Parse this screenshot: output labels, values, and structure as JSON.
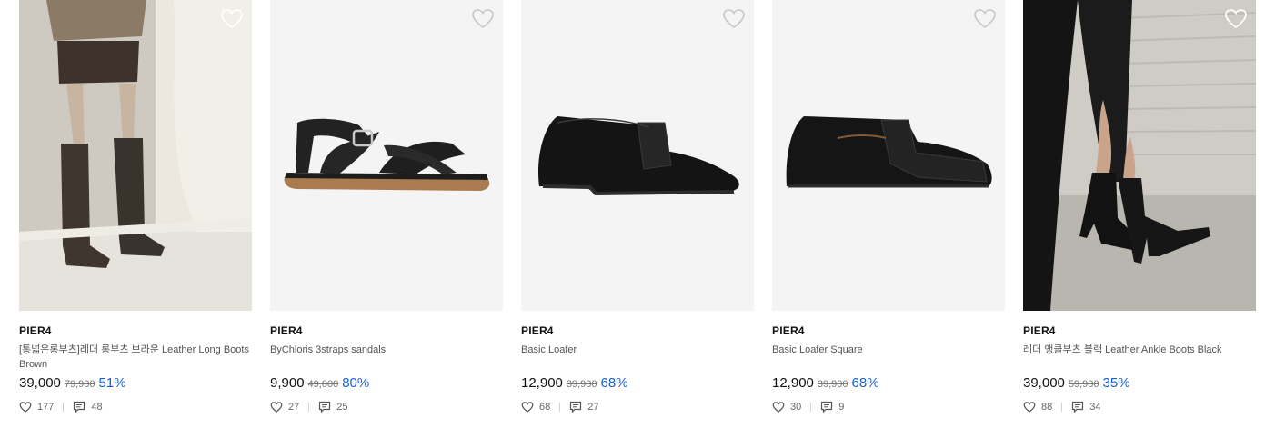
{
  "products": [
    {
      "brand": "PIER4",
      "name": "[통넓은롱부츠]레더 롱부츠 브라운 Leather Long Boots Brown",
      "price": "39,000",
      "original_price": "79,900",
      "discount": "51%",
      "likes": "177",
      "reviews": "48",
      "image": "brown-long-boots-photo"
    },
    {
      "brand": "PIER4",
      "name": "ByChloris 3straps sandals",
      "price": "9,900",
      "original_price": "49,000",
      "discount": "80%",
      "likes": "27",
      "reviews": "25",
      "image": "black-strap-sandal-photo"
    },
    {
      "brand": "PIER4",
      "name": "Basic Loafer",
      "price": "12,900",
      "original_price": "39,900",
      "discount": "68%",
      "likes": "68",
      "reviews": "27",
      "image": "black-loafer-photo"
    },
    {
      "brand": "PIER4",
      "name": "Basic Loafer Square",
      "price": "12,900",
      "original_price": "39,900",
      "discount": "68%",
      "likes": "30",
      "reviews": "9",
      "image": "black-square-loafer-photo"
    },
    {
      "brand": "PIER4",
      "name": "레더 앵클부츠 블랙 Leather Ankle Boots Black",
      "price": "39,000",
      "original_price": "59,900",
      "discount": "35%",
      "likes": "88",
      "reviews": "34",
      "image": "black-ankle-boots-photo"
    }
  ],
  "colors": {
    "discount": "#1a5fd0",
    "thumb_bg": "#f4f4f4"
  }
}
